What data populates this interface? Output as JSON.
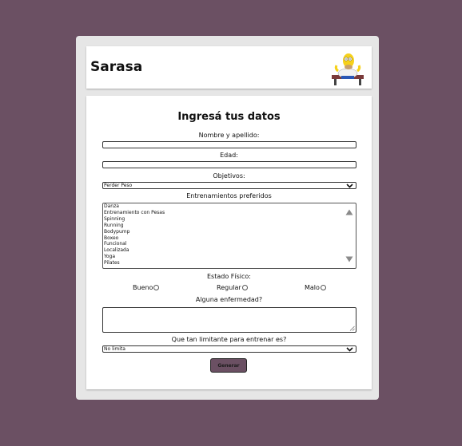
{
  "header": {
    "title": "Sarasa"
  },
  "form": {
    "title": "Ingresá tus datos",
    "name_label": "Nombre y apellido:",
    "age_label": "Edad:",
    "objectives_label": "Objetivos:",
    "objectives_value": "Perder Peso",
    "training_label": "Entrenamientos preferidos",
    "training_options": [
      "Danza",
      "Entrenamiento con Pesas",
      "Spinning",
      "Running",
      "Bodypump",
      "Boxeo",
      "Funcional",
      "Localizada",
      "Yoga",
      "Pilates"
    ],
    "physical_label": "Estado Físico:",
    "physical_options": [
      "Bueno",
      "Regular",
      "Malo"
    ],
    "illness_label": "Alguna enfermedad?",
    "limit_label": "Que tan limitante para entrenar es?",
    "limit_value": "No limita",
    "submit_label": "Generar"
  },
  "colors": {
    "background": "#6b5063",
    "button": "#6b5063"
  }
}
